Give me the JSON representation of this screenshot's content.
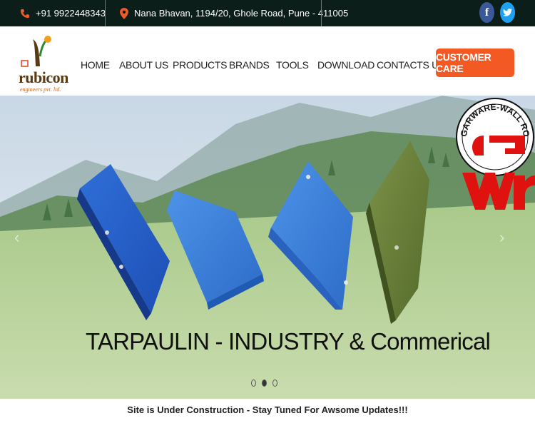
{
  "topbar": {
    "phone": "+91 9922448343",
    "address": "Nana Bhavan, 1194/20, Ghole Road, Pune - 411005",
    "social": [
      {
        "icon": "facebook-icon",
        "glyph": "f"
      },
      {
        "icon": "twitter-icon",
        "glyph": "t"
      }
    ]
  },
  "logo": {
    "name": "rubicon",
    "tagline": "engineers pvt. ltd."
  },
  "nav": {
    "items": [
      "HOME",
      "ABOUT US",
      "PRODUCTS",
      "BRANDS",
      "TOOLS",
      "DOWNLOAD",
      "CONTACTS US"
    ],
    "cta": "CUSTOMER CARE"
  },
  "hero": {
    "caption": "TARPAULIN - INDUSTRY & Commerical",
    "badge_text": "GARWARE-WALL ROPES",
    "badge_letters": "G wr",
    "slide_count": 3,
    "active_slide": 2,
    "prev_glyph": "‹",
    "next_glyph": "›"
  },
  "notice": "Site is Under Construction - Stay Tuned For Awsome Updates!!!",
  "colors": {
    "topbar_bg": "#0b1e1a",
    "accent_orange": "#f35a23",
    "facebook": "#3b5998",
    "twitter": "#1da1f2",
    "badge_red": "#e0120f"
  }
}
